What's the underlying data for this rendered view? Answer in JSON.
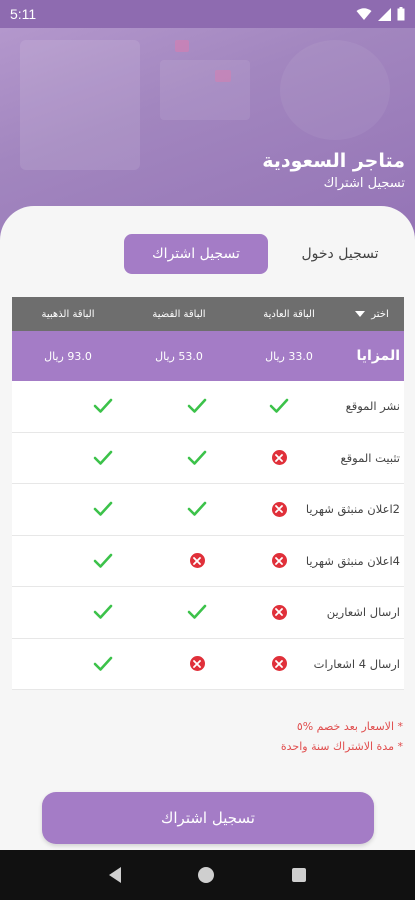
{
  "status_bar": {
    "time": "5:11"
  },
  "header": {
    "title": "متاجر السعودية",
    "subtitle": "تسجيل اشتراك"
  },
  "tabs": {
    "active": "تسجيل اشتراك",
    "inactive": "تسجيل دخول"
  },
  "table": {
    "select_label": "اختر",
    "columns": [
      "الباقة العادية",
      "الباقة الفضية",
      "الباقة الذهبية"
    ],
    "features_label": "المزايا",
    "prices": [
      "33.0 ريال",
      "53.0 ريال",
      "93.0 ريال"
    ],
    "rows": [
      {
        "label": "نشر الموقع",
        "values": [
          true,
          true,
          true
        ]
      },
      {
        "label": "تثبيت الموقع",
        "values": [
          false,
          true,
          true
        ]
      },
      {
        "label": "2اعلان منبثق شهريا",
        "values": [
          false,
          true,
          true
        ]
      },
      {
        "label": "4اعلان منبثق شهريا",
        "values": [
          false,
          false,
          true
        ]
      },
      {
        "label": "ارسال اشعارين",
        "values": [
          false,
          true,
          true
        ]
      },
      {
        "label": "ارسال 4 اشعارات",
        "values": [
          false,
          false,
          true
        ]
      }
    ]
  },
  "notes": [
    "* الاسعار بعد خصم %٥",
    "* مدة الاشتراك سنة واحدة"
  ],
  "subscribe_button": "تسجيل اشتراك",
  "colors": {
    "primary": "#a47cc6",
    "header_gray": "#6e6e6e",
    "check": "#3cc24a",
    "cross": "#e0303a",
    "note": "#e04d4d"
  }
}
